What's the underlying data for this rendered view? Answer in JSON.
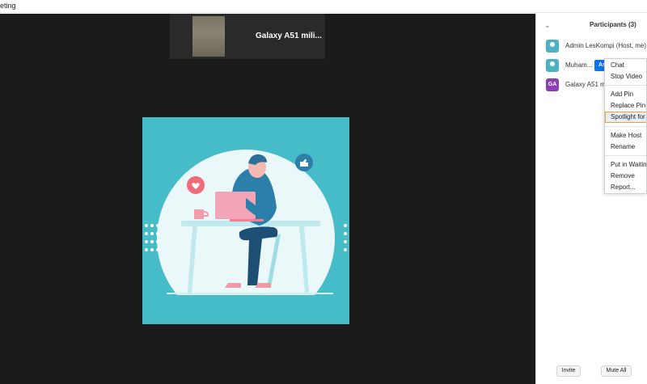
{
  "window": {
    "title": "eting"
  },
  "thumbnail": {
    "name": "Galaxy A51 mili..."
  },
  "panel": {
    "title": "Participants (3)",
    "participants": [
      {
        "name": "Admin LesKompi (Host, me)"
      },
      {
        "name": "Muham...",
        "badge": "As"
      },
      {
        "name": "Galaxy A51 mil",
        "initials": "GA"
      }
    ],
    "invite_label": "Invite",
    "mute_all_label": "Mute All"
  },
  "context_menu": {
    "items": [
      "Chat",
      "Stop Video",
      "Add Pin",
      "Replace Pin",
      "Spotlight for",
      "Make Host",
      "Rename",
      "Put in Waiting",
      "Remove",
      "Report..."
    ]
  },
  "colors": {
    "accent": "#0e72ed",
    "illustration_bg": "#46bcc8",
    "video_bg": "#1b1b1b",
    "highlight_border": "#f0a030"
  }
}
